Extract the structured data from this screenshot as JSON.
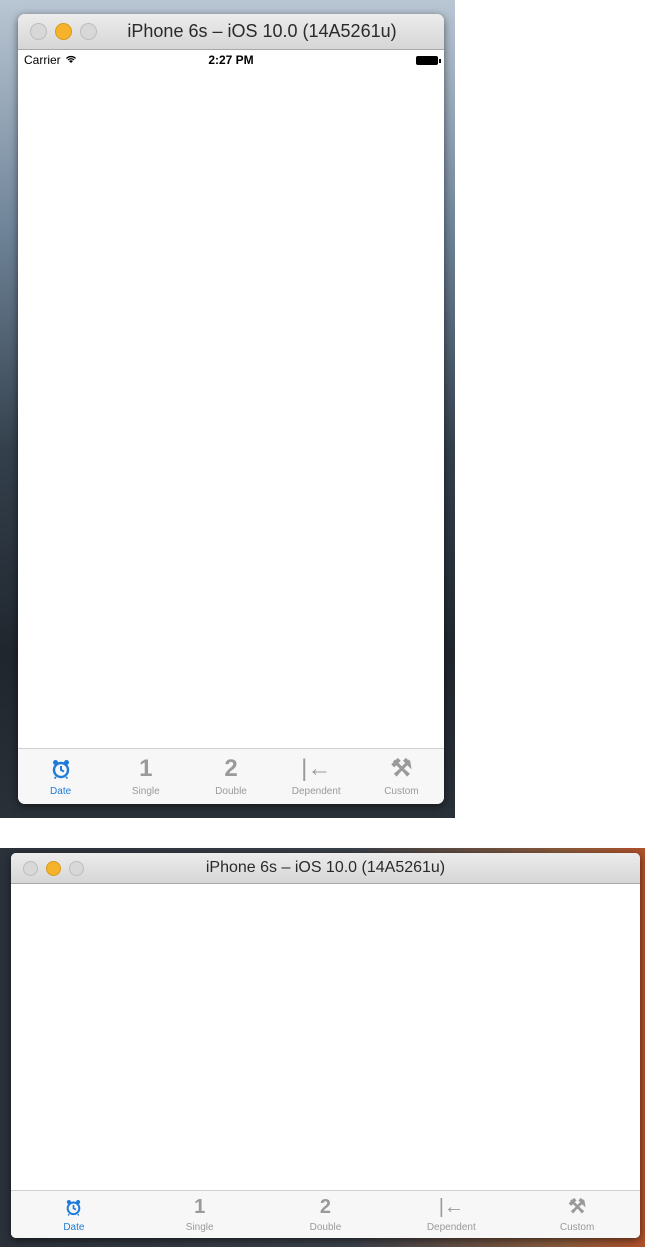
{
  "portrait_window": {
    "title": "iPhone 6s – iOS 10.0 (14A5261u)",
    "status_bar": {
      "carrier": "Carrier",
      "wifi_icon": "wifi-icon",
      "time": "2:27 PM",
      "battery_icon": "battery-icon"
    },
    "tabs": [
      {
        "label": "Date",
        "icon": "alarm-clock-icon",
        "glyph": "",
        "selected": true
      },
      {
        "label": "Single",
        "icon": "one-icon",
        "glyph": "1",
        "selected": false
      },
      {
        "label": "Double",
        "icon": "two-icon",
        "glyph": "2",
        "selected": false
      },
      {
        "label": "Dependent",
        "icon": "arrow-to-bar-icon",
        "glyph": "|←",
        "selected": false
      },
      {
        "label": "Custom",
        "icon": "tools-icon",
        "glyph": "⚒",
        "selected": false
      }
    ]
  },
  "landscape_window": {
    "title": "iPhone 6s – iOS 10.0 (14A5261u)",
    "tabs": [
      {
        "label": "Date",
        "icon": "alarm-clock-icon",
        "glyph": "",
        "selected": true
      },
      {
        "label": "Single",
        "icon": "one-icon",
        "glyph": "1",
        "selected": false
      },
      {
        "label": "Double",
        "icon": "two-icon",
        "glyph": "2",
        "selected": false
      },
      {
        "label": "Dependent",
        "icon": "arrow-to-bar-icon",
        "glyph": "|←",
        "selected": false
      },
      {
        "label": "Custom",
        "icon": "tools-icon",
        "glyph": "⚒",
        "selected": false
      }
    ]
  },
  "colors": {
    "selected_tab": "#1f7bd9",
    "unselected_tab": "#9a9a9a",
    "minimize_light": "#f5b32c"
  }
}
